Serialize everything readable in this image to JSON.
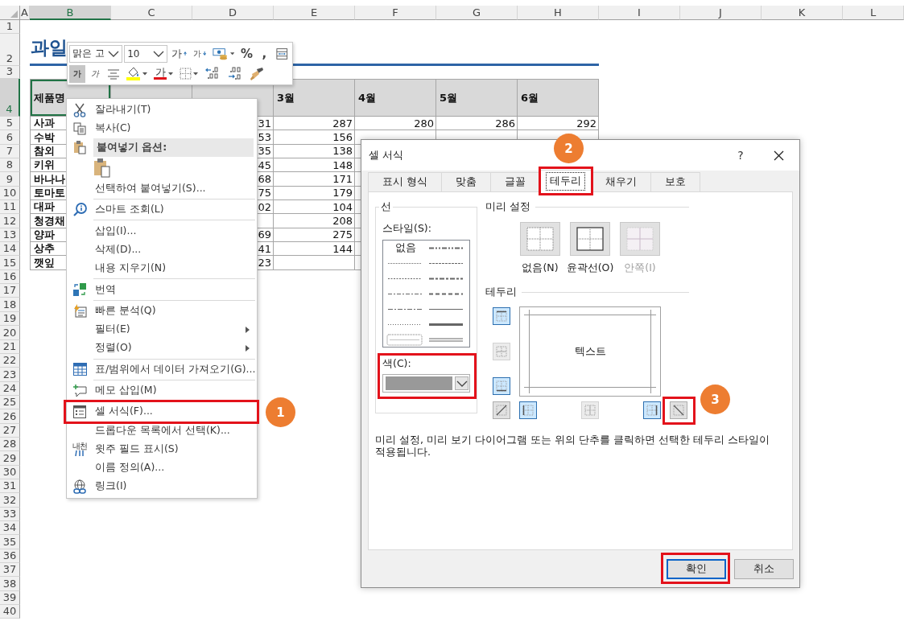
{
  "sheet": {
    "columns": [
      {
        "label": "A",
        "selected": false
      },
      {
        "label": "B",
        "selected": true
      },
      {
        "label": "C",
        "selected": false
      },
      {
        "label": "D",
        "selected": false
      },
      {
        "label": "E",
        "selected": false
      },
      {
        "label": "F",
        "selected": false
      },
      {
        "label": "G",
        "selected": false
      },
      {
        "label": "H",
        "selected": false
      },
      {
        "label": "I",
        "selected": false
      },
      {
        "label": "J",
        "selected": false
      },
      {
        "label": "K",
        "selected": false
      },
      {
        "label": "L",
        "selected": false
      }
    ],
    "rows": [
      {
        "label": "1",
        "selected": false
      },
      {
        "label": "2",
        "selected": false
      },
      {
        "label": "3",
        "selected": false
      },
      {
        "label": "4",
        "selected": true
      },
      {
        "label": "5",
        "selected": false
      },
      {
        "label": "6",
        "selected": false
      },
      {
        "label": "7",
        "selected": false
      },
      {
        "label": "8",
        "selected": false
      },
      {
        "label": "9",
        "selected": false
      },
      {
        "label": "10",
        "selected": false
      },
      {
        "label": "11",
        "selected": false
      },
      {
        "label": "12",
        "selected": false
      },
      {
        "label": "13",
        "selected": false
      },
      {
        "label": "14",
        "selected": false
      },
      {
        "label": "15",
        "selected": false
      },
      {
        "label": "16",
        "selected": false
      },
      {
        "label": "17",
        "selected": false
      },
      {
        "label": "18",
        "selected": false
      },
      {
        "label": "19",
        "selected": false
      },
      {
        "label": "20",
        "selected": false
      },
      {
        "label": "21",
        "selected": false
      },
      {
        "label": "22",
        "selected": false
      },
      {
        "label": "23",
        "selected": false
      },
      {
        "label": "24",
        "selected": false
      },
      {
        "label": "25",
        "selected": false
      },
      {
        "label": "26",
        "selected": false
      },
      {
        "label": "27",
        "selected": false
      },
      {
        "label": "28",
        "selected": false
      },
      {
        "label": "29",
        "selected": false
      },
      {
        "label": "30",
        "selected": false
      },
      {
        "label": "31",
        "selected": false
      },
      {
        "label": "32",
        "selected": false
      },
      {
        "label": "33",
        "selected": false
      },
      {
        "label": "34",
        "selected": false
      },
      {
        "label": "35",
        "selected": false
      },
      {
        "label": "36",
        "selected": false
      },
      {
        "label": "37",
        "selected": false
      },
      {
        "label": "38",
        "selected": false
      },
      {
        "label": "39",
        "selected": false
      },
      {
        "label": "40",
        "selected": false
      }
    ],
    "title": "과일",
    "table": {
      "name_header": "제품명",
      "month_headers": [
        "3월",
        "4월",
        "5월",
        "6월"
      ],
      "rows": [
        [
          "사과",
          null,
          "31",
          "287",
          "280",
          "286",
          "292"
        ],
        [
          "수박",
          null,
          "53",
          "156",
          null,
          null,
          null
        ],
        [
          "참외",
          null,
          "35",
          "138",
          null,
          null,
          null
        ],
        [
          "키위",
          null,
          "45",
          "148",
          null,
          null,
          null
        ],
        [
          "바나나",
          null,
          "68",
          "171",
          null,
          null,
          null
        ],
        [
          "토마토",
          null,
          "75",
          "179",
          null,
          null,
          null
        ],
        [
          "대파",
          null,
          "02",
          "104",
          null,
          null,
          null
        ],
        [
          "청경채",
          null,
          null,
          "208",
          null,
          null,
          null
        ],
        [
          "양파",
          null,
          "69",
          "275",
          null,
          null,
          null
        ],
        [
          "상추",
          null,
          "41",
          "144",
          null,
          null,
          null
        ],
        [
          "깻잎",
          null,
          "23",
          null,
          null,
          null,
          null
        ]
      ]
    }
  },
  "mini_toolbar": {
    "font": "맑은 고",
    "size": "10",
    "row_1": [
      {
        "kind": "grow-font",
        "label": "가"
      },
      {
        "kind": "shrink-font",
        "label": "가"
      },
      {
        "kind": "accounting"
      },
      {
        "kind": "percent",
        "label": "%"
      },
      {
        "kind": "comma",
        "label": ","
      },
      {
        "kind": "wrap"
      }
    ],
    "row_2": [
      {
        "kind": "bold",
        "label": "가",
        "pressed": true
      },
      {
        "kind": "italic",
        "label": "가",
        "pressed": false
      },
      {
        "kind": "center",
        "pressed": false
      },
      {
        "kind": "fill-color",
        "pressed": false
      },
      {
        "kind": "font-color",
        "label": "가",
        "pressed": false
      },
      {
        "kind": "borders",
        "pressed": false
      },
      {
        "kind": "increase-decimal",
        "pressed": false
      },
      {
        "kind": "decrease-decimal",
        "pressed": false
      },
      {
        "kind": "format-painter",
        "pressed": false
      }
    ]
  },
  "context_menu": {
    "items": [
      {
        "kind": "cut",
        "label": "잘라내기(T)",
        "highlighted": false
      },
      {
        "kind": "copy",
        "label": "복사(C)",
        "highlighted": false
      },
      {
        "kind": "paste-header",
        "label": "붙여넣기 옵션:",
        "highlighted": false
      },
      {
        "kind": "paste-options",
        "highlighted": false
      },
      {
        "kind": "plain",
        "label": "선택하여 붙여넣기(S)...",
        "highlighted": false
      },
      {
        "kind": "separator",
        "highlighted": false
      },
      {
        "kind": "smart-lookup",
        "label": "스마트 조회(L)",
        "highlighted": false
      },
      {
        "kind": "separator",
        "highlighted": false
      },
      {
        "kind": "plain",
        "label": "삽입(I)...",
        "highlighted": false
      },
      {
        "kind": "plain",
        "label": "삭제(D)...",
        "highlighted": false
      },
      {
        "kind": "plain",
        "label": "내용 지우기(N)",
        "highlighted": false
      },
      {
        "kind": "separator",
        "highlighted": false
      },
      {
        "kind": "translate",
        "label": "번역",
        "highlighted": false
      },
      {
        "kind": "separator",
        "highlighted": false
      },
      {
        "kind": "quick-analysis",
        "label": "빠른 분석(Q)",
        "highlighted": false
      },
      {
        "kind": "submenu",
        "label": "필터(E)",
        "highlighted": false
      },
      {
        "kind": "submenu",
        "label": "정렬(O)",
        "highlighted": false
      },
      {
        "kind": "separator",
        "highlighted": false
      },
      {
        "kind": "get-data",
        "label": "표/범위에서 데이터 가져오기(G)...",
        "highlighted": false
      },
      {
        "kind": "separator",
        "highlighted": false
      },
      {
        "kind": "comment",
        "label": "메모 삽입(M)",
        "highlighted": false
      },
      {
        "kind": "separator",
        "highlighted": false
      },
      {
        "kind": "format-cells",
        "label": "셀 서식(F)...",
        "highlighted": true
      },
      {
        "kind": "plain",
        "label": "드롭다운 목록에서 선택(K)...",
        "highlighted": false
      },
      {
        "kind": "phonetic",
        "label": "윗주 필드 표시(S)",
        "icon_text": "내천",
        "highlighted": false
      },
      {
        "kind": "plain",
        "label": "이름 정의(A)...",
        "highlighted": false
      },
      {
        "kind": "link",
        "label": "링크(I)",
        "highlighted": false
      }
    ]
  },
  "dialog": {
    "title": "셀 서식",
    "help": "?",
    "tabs": [
      {
        "label": "표시 형식",
        "selected": false,
        "highlighted": false
      },
      {
        "label": "맞춤",
        "selected": false,
        "highlighted": false
      },
      {
        "label": "글꼴",
        "selected": false,
        "highlighted": false
      },
      {
        "label": "테두리",
        "selected": true,
        "highlighted": true
      },
      {
        "label": "채우기",
        "selected": false,
        "highlighted": false
      },
      {
        "label": "보호",
        "selected": false,
        "highlighted": false
      }
    ],
    "line_group": {
      "title": "선",
      "style_label": "스타일(S):",
      "none_label": "없음",
      "color_label": "색(C):",
      "color": "#999999",
      "highlighted": true
    },
    "presets": {
      "title": "미리 설정",
      "items": [
        {
          "kind": "none",
          "label": "없음(N)",
          "disabled": false
        },
        {
          "kind": "outline",
          "label": "윤곽선(O)",
          "disabled": false
        },
        {
          "kind": "inside",
          "label": "안쪽(I)",
          "disabled": true
        }
      ]
    },
    "border": {
      "title": "테두리",
      "preview_text": "텍스트",
      "buttons": [
        {
          "kind": "top",
          "on": true,
          "disabled": false,
          "highlighted": false
        },
        {
          "kind": "middle-h",
          "on": false,
          "disabled": true,
          "highlighted": false
        },
        {
          "kind": "bottom",
          "on": true,
          "disabled": false,
          "highlighted": false
        },
        {
          "kind": "diag-up",
          "on": false,
          "disabled": false,
          "highlighted": false
        },
        {
          "kind": "left",
          "on": true,
          "disabled": false,
          "highlighted": false
        },
        {
          "kind": "middle-v",
          "on": false,
          "disabled": true,
          "highlighted": false
        },
        {
          "kind": "right",
          "on": true,
          "disabled": false,
          "highlighted": false
        },
        {
          "kind": "diag-down",
          "on": false,
          "disabled": false,
          "highlighted": true
        }
      ]
    },
    "hint": "미리 설정, 미리 보기 다이어그램 또는 위의 단추를 클릭하면 선택한 테두리 스타일이 적용됩니다.",
    "buttons": [
      {
        "label": "확인",
        "default": true,
        "highlighted": true
      },
      {
        "label": "취소",
        "default": false,
        "highlighted": false
      }
    ]
  },
  "callouts": [
    {
      "label": "1"
    },
    {
      "label": "2"
    },
    {
      "label": "3"
    }
  ]
}
